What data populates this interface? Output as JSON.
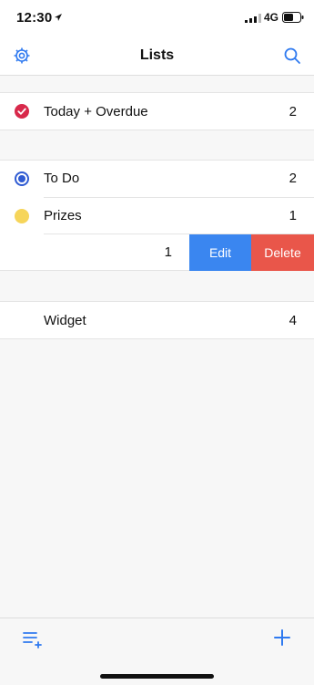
{
  "status": {
    "time": "12:30",
    "network": "4G"
  },
  "nav": {
    "title": "Lists"
  },
  "sections": {
    "smart": {
      "label": "Today + Overdue",
      "count": "2"
    },
    "lists": [
      {
        "label": "To Do",
        "count": "2"
      },
      {
        "label": "Prizes",
        "count": "1"
      }
    ],
    "swiped": {
      "count": "1",
      "edit_label": "Edit",
      "delete_label": "Delete"
    },
    "other": {
      "label": "Widget",
      "count": "4"
    }
  },
  "colors": {
    "accent": "#2f7af0",
    "today": "#d8294b",
    "todo": "#2f5bd2",
    "prizes": "#f6d55a",
    "edit": "#3a86f0",
    "delete": "#e9564a"
  },
  "icons": {
    "settings": "gear-icon",
    "search": "search-icon",
    "new_list": "new-list-icon",
    "add": "plus-icon"
  }
}
